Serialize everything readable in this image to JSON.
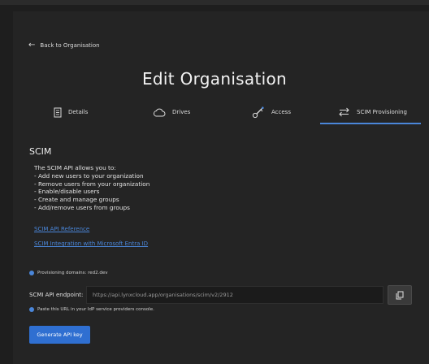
{
  "back_label": "Back to Organisation",
  "page_title": "Edit Organisation",
  "tabs": [
    {
      "label": "Details",
      "icon": "document-icon"
    },
    {
      "label": "Drives",
      "icon": "cloud-icon"
    },
    {
      "label": "Access",
      "icon": "key-icon"
    },
    {
      "label": "SCIM Provisioning",
      "icon": "swap-arrows-icon",
      "active": true
    }
  ],
  "scim": {
    "section_title": "SCIM",
    "description_lines": [
      "The SCIM API allows you to:",
      "- Add new users to your organization",
      "- Remove users from your organization",
      "- Enable/disable users",
      "- Create and manage groups",
      "- Add/remove users from groups"
    ],
    "links": [
      "SCIM API Reference",
      "SCIM Integration with Microsoft Entra ID"
    ],
    "provisioning_domains": "Provisioning domains: red2.dev",
    "endpoint_label": "SCMI API endpoint:",
    "endpoint_value": "https://api.lynxcloud.app/organisations/scim/v2/2912",
    "paste_hint": "Paste this URL in your IdP service providers console.",
    "generate_button": "Generate API key"
  },
  "colors": {
    "accent": "#4a86d9",
    "button": "#2f6fd1",
    "background": "#242424"
  }
}
